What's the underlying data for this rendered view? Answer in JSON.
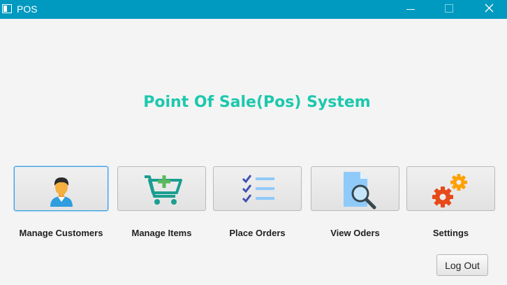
{
  "window": {
    "title": "POS"
  },
  "main": {
    "heading": "Point Of Sale(Pos) System"
  },
  "menu": [
    {
      "label": "Manage Customers",
      "icon": "customer-avatar-icon"
    },
    {
      "label": "Manage Items",
      "icon": "cart-add-icon"
    },
    {
      "label": "Place Orders",
      "icon": "checklist-icon"
    },
    {
      "label": "View Oders",
      "icon": "document-search-icon"
    },
    {
      "label": "Settings",
      "icon": "gears-icon"
    }
  ],
  "actions": {
    "logout_label": "Log Out"
  },
  "colors": {
    "titlebar": "#0099bf",
    "heading": "#1dc8ad",
    "background": "#f4f4f4",
    "focus": "#3d9ee3"
  }
}
